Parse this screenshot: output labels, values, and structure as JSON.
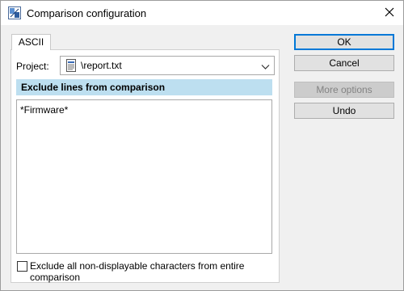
{
  "window": {
    "title": "Comparison configuration"
  },
  "tabs": [
    {
      "label": "ASCII"
    }
  ],
  "form": {
    "project_label": "Project:",
    "project_value": "\\report.txt",
    "section_title": "Exclude lines from comparison",
    "exclude_text": "*Firmware*",
    "exclude_nondisplayable_label": "Exclude all non-displayable characters from entire comparison",
    "exclude_nondisplayable_checked": false
  },
  "buttons": {
    "ok": "OK",
    "cancel": "Cancel",
    "more_options": "More options",
    "undo": "Undo"
  },
  "icons": {
    "app": "comparison-app-icon",
    "file": "text-file-icon",
    "dropdown": "chevron-down-icon",
    "close": "close-icon"
  },
  "colors": {
    "accent": "#0078d7",
    "section_header_bg": "#bddff0",
    "disabled_text": "#838383"
  }
}
